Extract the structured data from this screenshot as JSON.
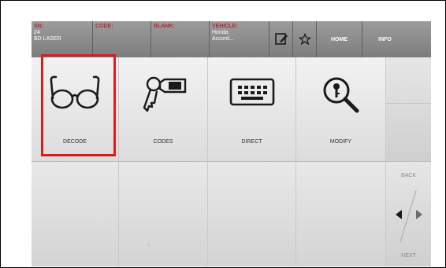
{
  "topbar": {
    "sn_label": "SN:",
    "sn_value1": "24",
    "sn_value2": "BD LASER",
    "code_label": "CODE:",
    "blank_label": "BLANK:",
    "vehicle_label": "VEHICLE:",
    "vehicle_value1": "Honda",
    "vehicle_value2": "Accord...",
    "home_label": "HOME",
    "info_label": "INFO"
  },
  "menu": {
    "decode": "DECODE",
    "codes": "CODES",
    "direct": "DIRECT",
    "modify": "MODIFY"
  },
  "nav": {
    "back": "BACK",
    "next": "NEXT"
  },
  "colors": {
    "highlight": "#e01a1a",
    "label_red": "#c0262f"
  }
}
